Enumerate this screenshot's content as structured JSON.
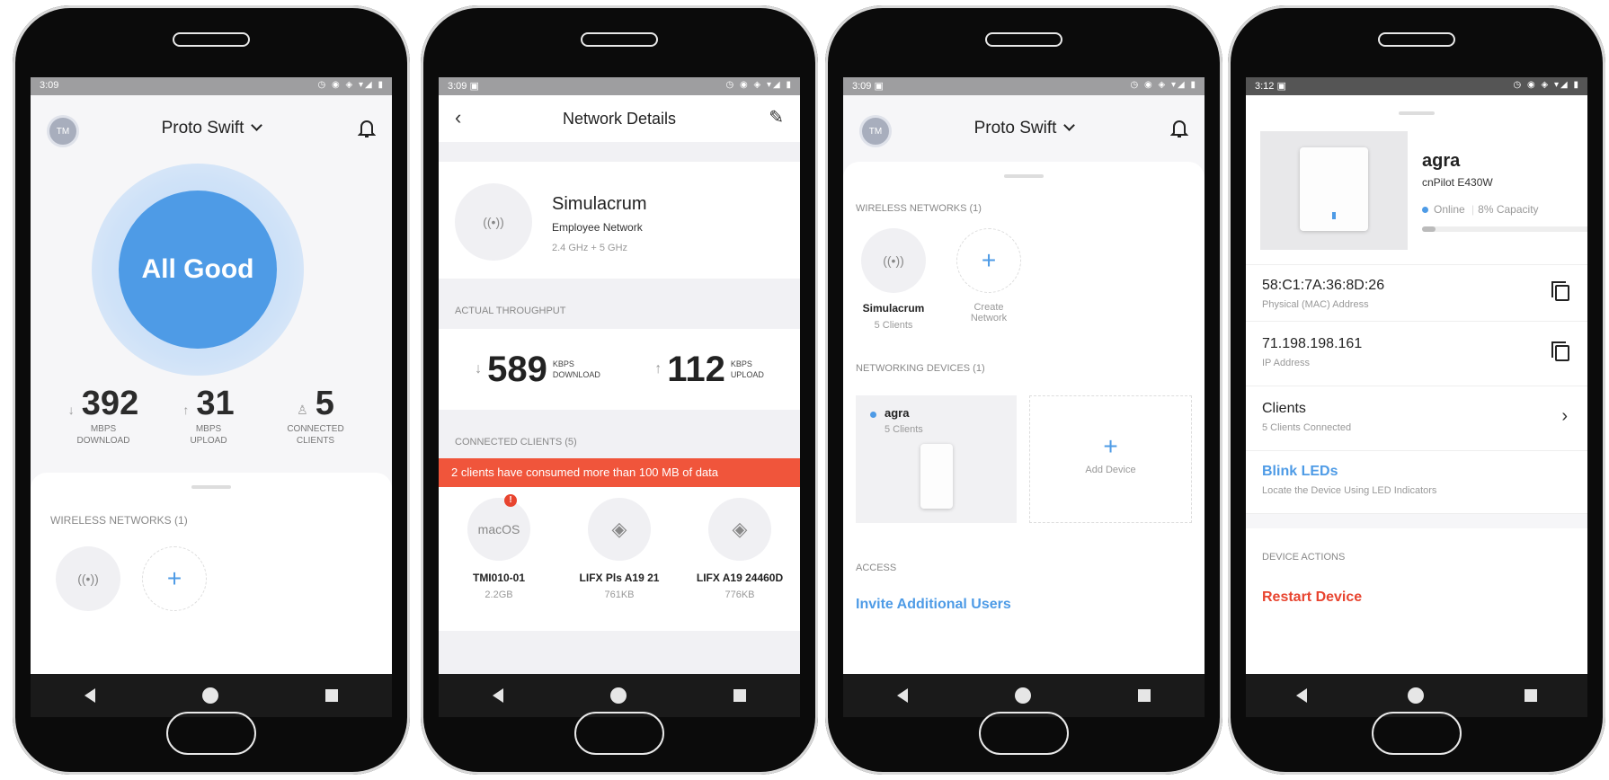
{
  "phone1": {
    "status_time": "3:09",
    "avatar": "TM",
    "title": "Proto Swift",
    "hero": "All Good",
    "stats": [
      {
        "value": "392",
        "unit1": "MBPS",
        "unit2": "DOWNLOAD",
        "icon": "arrow-down-icon"
      },
      {
        "value": "31",
        "unit1": "MBPS",
        "unit2": "UPLOAD",
        "icon": "arrow-up-icon"
      },
      {
        "value": "5",
        "unit1": "CONNECTED",
        "unit2": "CLIENTS",
        "icon": "user-icon"
      }
    ],
    "wireless_header": "WIRELESS NETWORKS (1)"
  },
  "phone2": {
    "status_time": "3:09",
    "title": "Network Details",
    "network_name": "Simulacrum",
    "network_type": "Employee Network",
    "network_bands": "2.4 GHz + 5 GHz",
    "throughput_header": "ACTUAL THROUGHPUT",
    "download_value": "589",
    "download_unit1": "KBPS",
    "download_unit2": "DOWNLOAD",
    "upload_value": "112",
    "upload_unit1": "KBPS",
    "upload_unit2": "UPLOAD",
    "clients_header": "CONNECTED CLIENTS (5)",
    "alert": "2 clients have consumed more than 100 MB of data",
    "clients": [
      {
        "icon_text": "macOS",
        "name": "TMI010-01",
        "usage": "2.2GB",
        "badge": "!"
      },
      {
        "icon_text": "",
        "name": "LIFX Pls A19 21",
        "usage": "761KB"
      },
      {
        "icon_text": "",
        "name": "LIFX A19 24460D",
        "usage": "776KB"
      }
    ]
  },
  "phone3": {
    "status_time": "3:09",
    "avatar": "TM",
    "title": "Proto Swift",
    "wireless_header": "WIRELESS NETWORKS (1)",
    "network_name": "Simulacrum",
    "network_clients": "5 Clients",
    "create_label1": "Create",
    "create_label2": "Network",
    "devices_header": "NETWORKING DEVICES (1)",
    "device_name": "agra",
    "device_clients": "5 Clients",
    "add_device": "Add Device",
    "access_header": "ACCESS",
    "invite": "Invite Additional Users"
  },
  "phone4": {
    "status_time": "3:12",
    "device_name": "agra",
    "device_model": "cnPilot E430W",
    "online": "Online",
    "capacity": "8% Capacity",
    "capacity_fraction": 0.08,
    "mac": "58:C1:7A:36:8D:26",
    "mac_label": "Physical (MAC) Address",
    "ip": "71.198.198.161",
    "ip_label": "IP Address",
    "clients": "Clients",
    "clients_sub": "5 Clients Connected",
    "blink": "Blink LEDs",
    "blink_sub": "Locate the Device Using LED Indicators",
    "actions_header": "DEVICE ACTIONS",
    "restart": "Restart Device"
  },
  "colors": {
    "accent": "#4e9be6",
    "alert": "#f0553b",
    "danger": "#e8442f"
  }
}
